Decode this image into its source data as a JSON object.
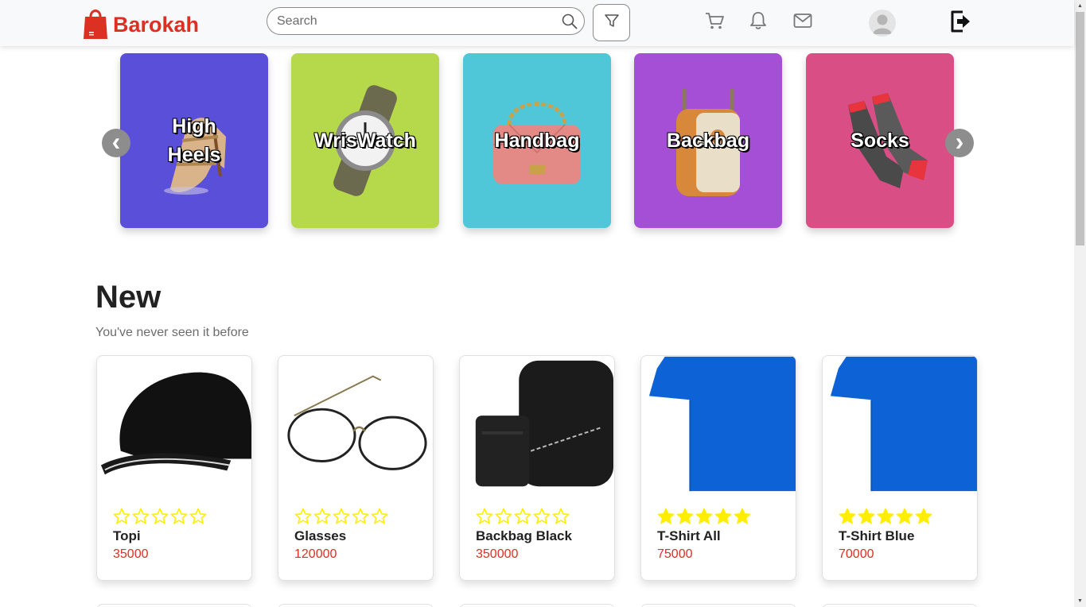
{
  "brand": {
    "name": "Barokah",
    "icon": "shopping-bag-icon",
    "color": "#db3022"
  },
  "search": {
    "placeholder": "Search",
    "icon": "search-icon"
  },
  "nav_icons": [
    "filter-icon",
    "cart-icon",
    "bell-icon",
    "mail-icon",
    "avatar",
    "logout-icon"
  ],
  "categories": [
    {
      "label": "High Heels",
      "color": "#5a4fd9"
    },
    {
      "label": "WrisWatch",
      "color": "#b6d94c"
    },
    {
      "label": "Handbag",
      "color": "#50c7d8"
    },
    {
      "label": "Backbag",
      "color": "#a54fd6"
    },
    {
      "label": "Socks",
      "color": "#d94f85"
    }
  ],
  "carousel": {
    "prev_glyph": "‹",
    "next_glyph": "›"
  },
  "section": {
    "title": "New",
    "subtitle": "You've never seen it before"
  },
  "products": [
    {
      "name": "Topi",
      "price": "35000",
      "rating": 0
    },
    {
      "name": "Glasses",
      "price": "120000",
      "rating": 0
    },
    {
      "name": "Backbag Black",
      "price": "350000",
      "rating": 0
    },
    {
      "name": "T-Shirt All",
      "price": "75000",
      "rating": 5
    },
    {
      "name": "T-Shirt Blue",
      "price": "70000",
      "rating": 5
    }
  ],
  "colors": {
    "accent": "#db3022",
    "star": "#ffee00",
    "navbar": "#f8f9fa"
  }
}
